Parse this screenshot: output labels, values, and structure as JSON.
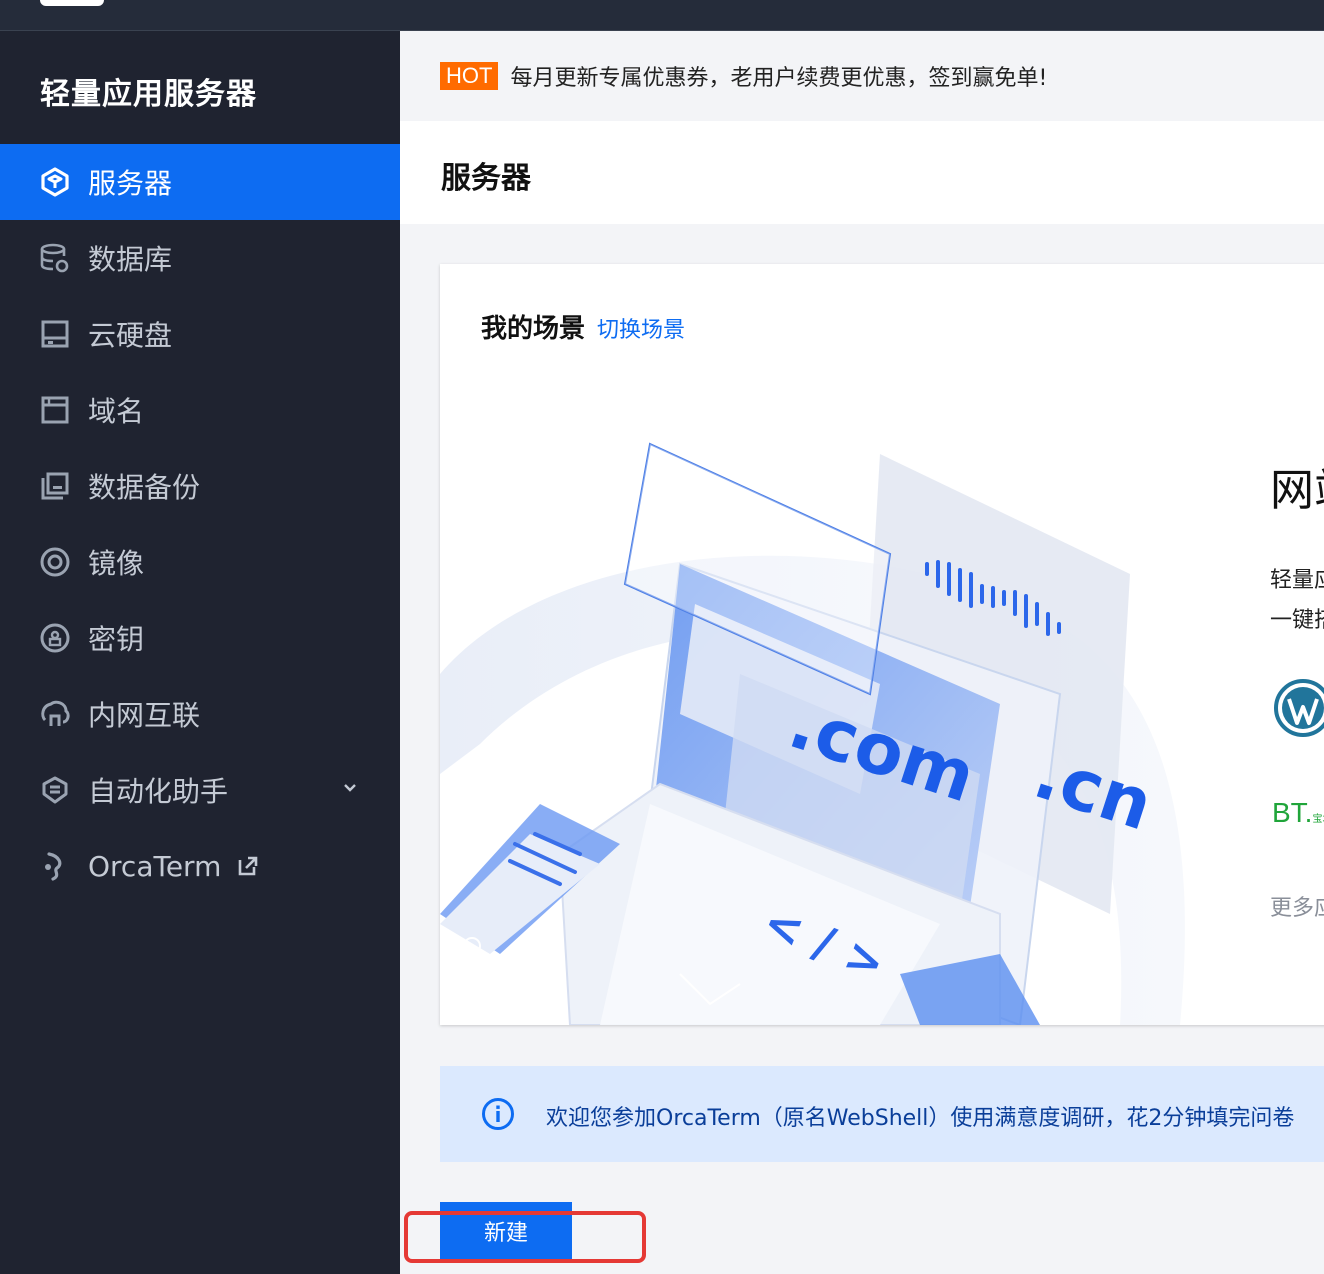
{
  "sidebar": {
    "product_title": "轻量应用服务器",
    "items": [
      {
        "label": "服务器",
        "icon": "server-icon",
        "active": true
      },
      {
        "label": "数据库",
        "icon": "database-icon"
      },
      {
        "label": "云硬盘",
        "icon": "cloud-disk-icon"
      },
      {
        "label": "域名",
        "icon": "domain-icon"
      },
      {
        "label": "数据备份",
        "icon": "backup-icon"
      },
      {
        "label": "镜像",
        "icon": "image-icon"
      },
      {
        "label": "密钥",
        "icon": "key-icon"
      },
      {
        "label": "内网互联",
        "icon": "intranet-icon"
      },
      {
        "label": "自动化助手",
        "icon": "automation-icon",
        "expandable": true
      },
      {
        "label": "OrcaTerm",
        "icon": "orcaterm-icon",
        "external": true
      }
    ]
  },
  "notice": {
    "badge": "HOT",
    "text": "每月更新专属优惠券，老用户续费更优惠，签到赢免单!"
  },
  "page": {
    "title": "服务器"
  },
  "scene": {
    "title": "我的场景",
    "switch_label": "切换场景",
    "big_text": "网站",
    "desc_line1": "轻量应用",
    "desc_line2": "一键搭建",
    "bt_text": "BT.",
    "bt_small": "宝塔 cn",
    "more_label": "更多应用"
  },
  "alert": {
    "text": "欢迎您参加OrcaTerm（原名WebShell）使用满意度调研，花2分钟填完问卷"
  },
  "actions": {
    "new_label": "新建"
  },
  "colors": {
    "sidebar_bg": "#1f2330",
    "accent": "#0d6cf2",
    "hot": "#ff6b00",
    "alert_bg": "#dbe9fe",
    "highlight": "#e53935"
  }
}
